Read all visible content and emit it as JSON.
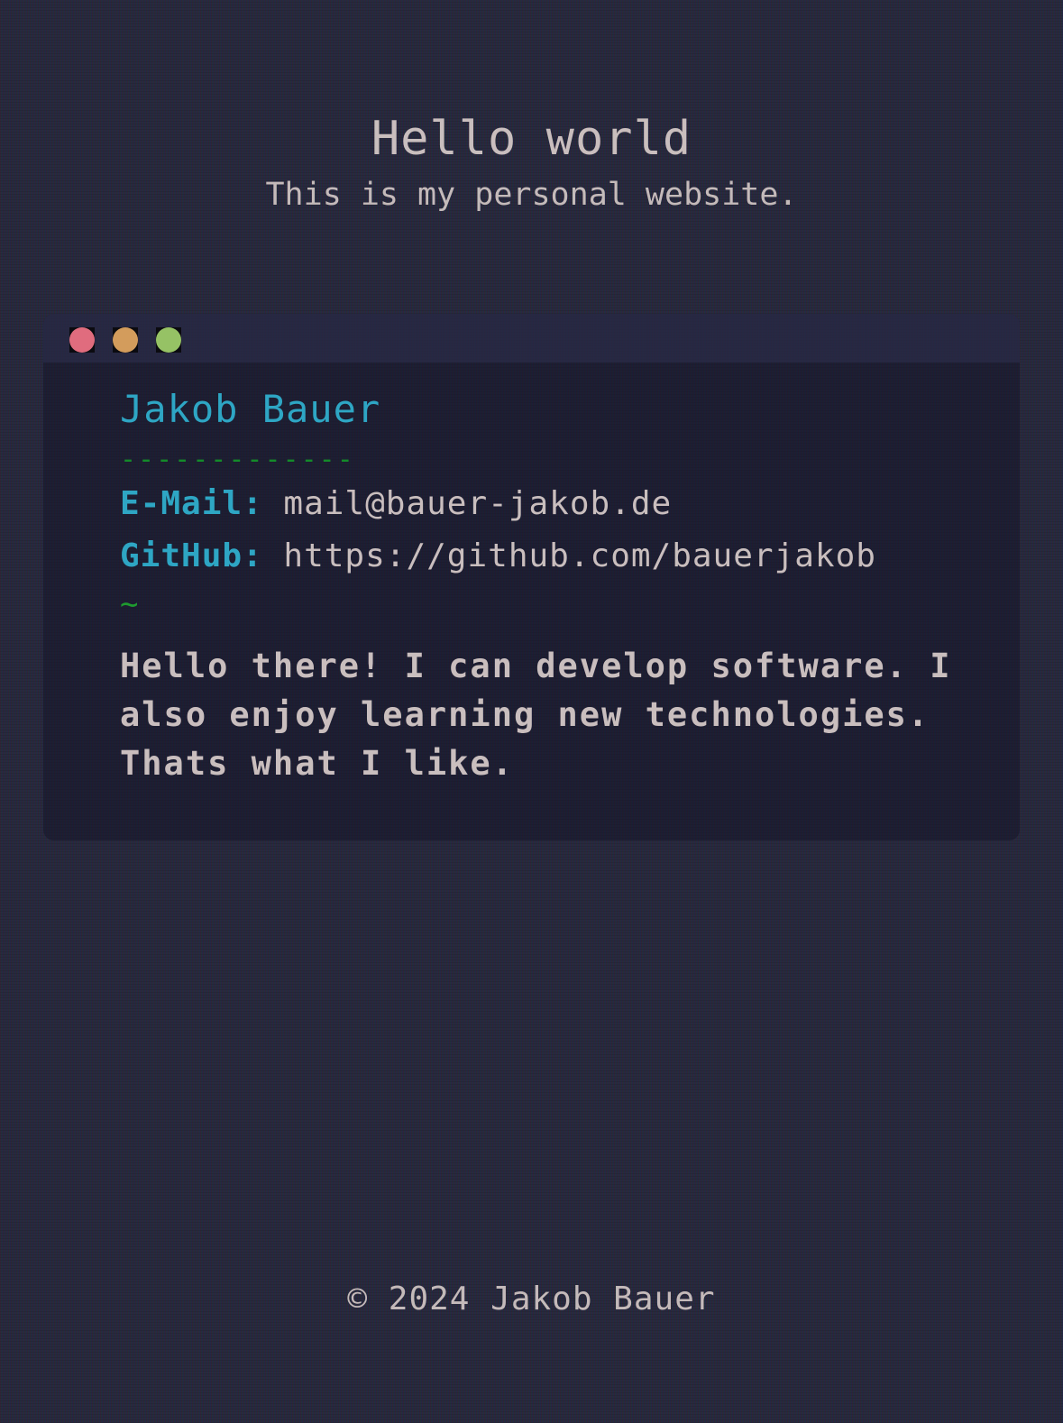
{
  "header": {
    "title": "Hello world",
    "subtitle": "This is my personal website."
  },
  "terminal": {
    "window_buttons": [
      "close",
      "minimize",
      "maximize"
    ],
    "button_colors": {
      "close": "#e06c7e",
      "minimize": "#d39c5c",
      "maximize": "#96c265"
    },
    "name": "Jakob Bauer",
    "divider": "-------------",
    "email": {
      "label": "E-Mail:",
      "value": "mail@bauer-jakob.de"
    },
    "github": {
      "label": "GitHub:",
      "value": "https://github.com/bauerjakob"
    },
    "prompt": "~",
    "bio": "Hello there! I can develop software. I also enjoy learning new technologies. Thats what I like."
  },
  "footer": {
    "copyright": "© 2024 Jakob Bauer"
  },
  "colors": {
    "background": "#232438",
    "accent": "#2ea6c4",
    "prompt_green": "#1e9b2f",
    "text": "#c9bebe"
  }
}
